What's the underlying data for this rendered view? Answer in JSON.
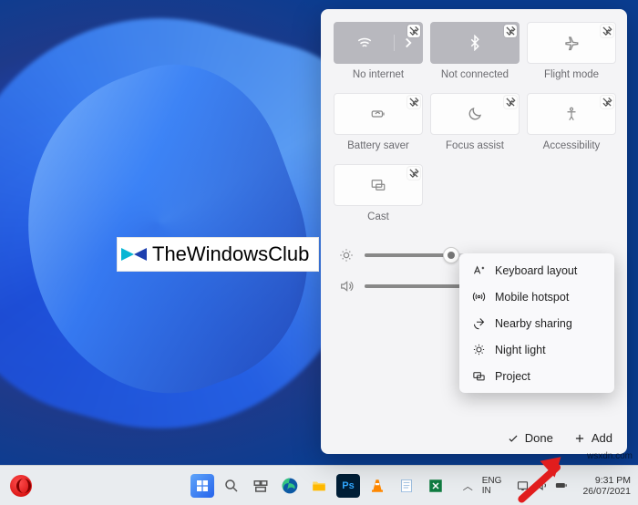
{
  "watermark": {
    "text": "TheWindowsClub"
  },
  "corner_text": "wsxdn.com",
  "tiles": [
    {
      "id": "wifi",
      "label": "No internet",
      "dark": true,
      "split": true
    },
    {
      "id": "bluetooth",
      "label": "Not connected",
      "dark": true
    },
    {
      "id": "flight",
      "label": "Flight mode"
    },
    {
      "id": "battery",
      "label": "Battery saver"
    },
    {
      "id": "focus",
      "label": "Focus assist"
    },
    {
      "id": "accessibility",
      "label": "Accessibility"
    },
    {
      "id": "cast",
      "label": "Cast"
    }
  ],
  "sliders": {
    "brightness_pct": 35,
    "volume_pct": 70
  },
  "footer": {
    "done": "Done",
    "add": "Add"
  },
  "add_menu": [
    {
      "id": "keyboard",
      "label": "Keyboard layout"
    },
    {
      "id": "hotspot",
      "label": "Mobile hotspot"
    },
    {
      "id": "nearby",
      "label": "Nearby sharing"
    },
    {
      "id": "nightlight",
      "label": "Night light"
    },
    {
      "id": "project",
      "label": "Project"
    }
  ],
  "taskbar": {
    "lang_top": "ENG",
    "lang_bottom": "IN",
    "time": "9:31 PM",
    "date": "26/07/2021"
  }
}
